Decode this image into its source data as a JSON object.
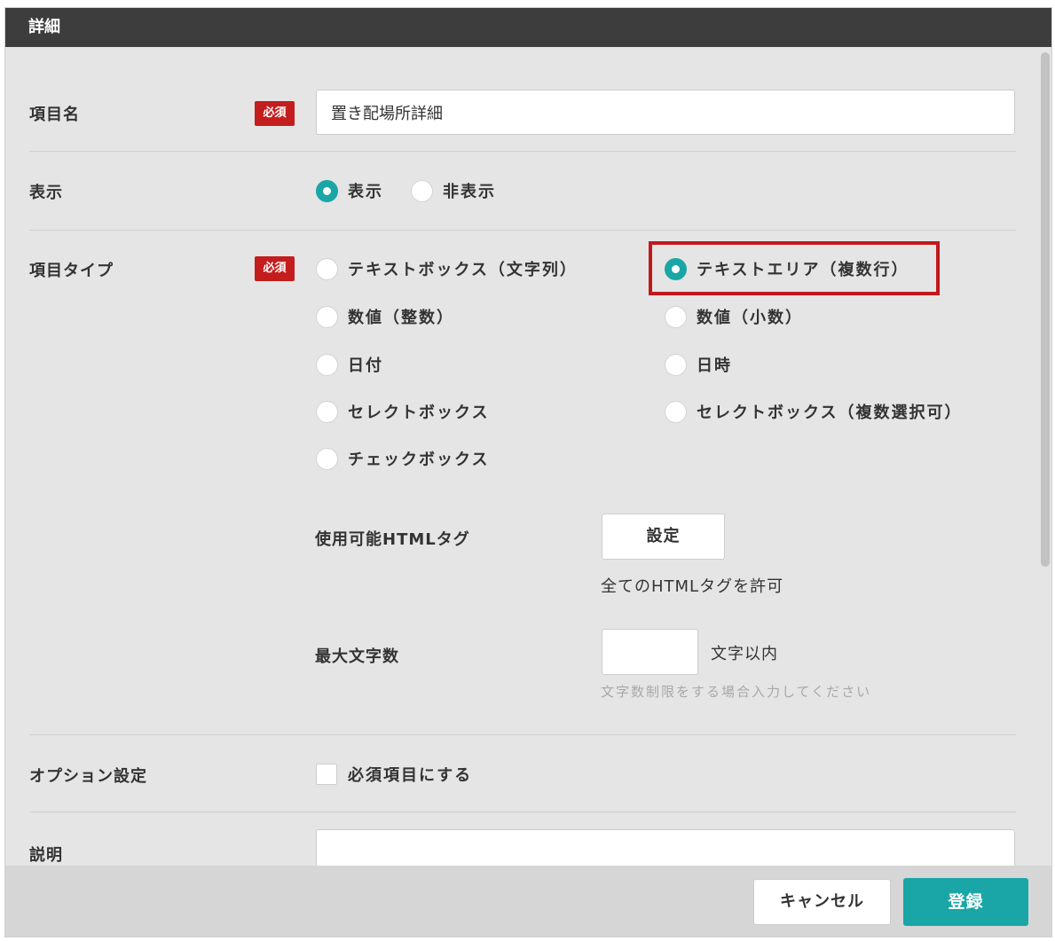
{
  "dialog": {
    "title": "詳細"
  },
  "item_name": {
    "label": "項目名",
    "required_badge": "必須",
    "value": "置き配場所詳細"
  },
  "display": {
    "label": "表示",
    "options": [
      {
        "label": "表示",
        "checked": true
      },
      {
        "label": "非表示",
        "checked": false
      }
    ]
  },
  "item_type": {
    "label": "項目タイプ",
    "required_badge": "必須",
    "options": [
      {
        "label": "テキストボックス（文字列）",
        "checked": false
      },
      {
        "label": "テキストエリア（複数行）",
        "checked": true
      },
      {
        "label": "数値（整数）",
        "checked": false
      },
      {
        "label": "数値（小数）",
        "checked": false
      },
      {
        "label": "日付",
        "checked": false
      },
      {
        "label": "日時",
        "checked": false
      },
      {
        "label": "セレクトボックス",
        "checked": false
      },
      {
        "label": "セレクトボックス（複数選択可）",
        "checked": false
      },
      {
        "label": "チェックボックス",
        "checked": false
      }
    ],
    "html_tags": {
      "label": "使用可能HTMLタグ",
      "button_label": "設定",
      "status": "全てのHTMLタグを許可"
    },
    "max_chars": {
      "label": "最大文字数",
      "value": "",
      "suffix": "文字以内",
      "hint": "文字数制限をする場合入力してください"
    }
  },
  "options_setting": {
    "label": "オプション設定",
    "checkbox_label": "必須項目にする",
    "checked": false
  },
  "description": {
    "label": "説明",
    "value": ""
  },
  "footer": {
    "cancel_label": "キャンセル",
    "submit_label": "登録"
  },
  "colors": {
    "accent": "#1aa6a6",
    "required": "#c41d1d",
    "highlight": "#c0191d",
    "header": "#3d3d3d"
  }
}
